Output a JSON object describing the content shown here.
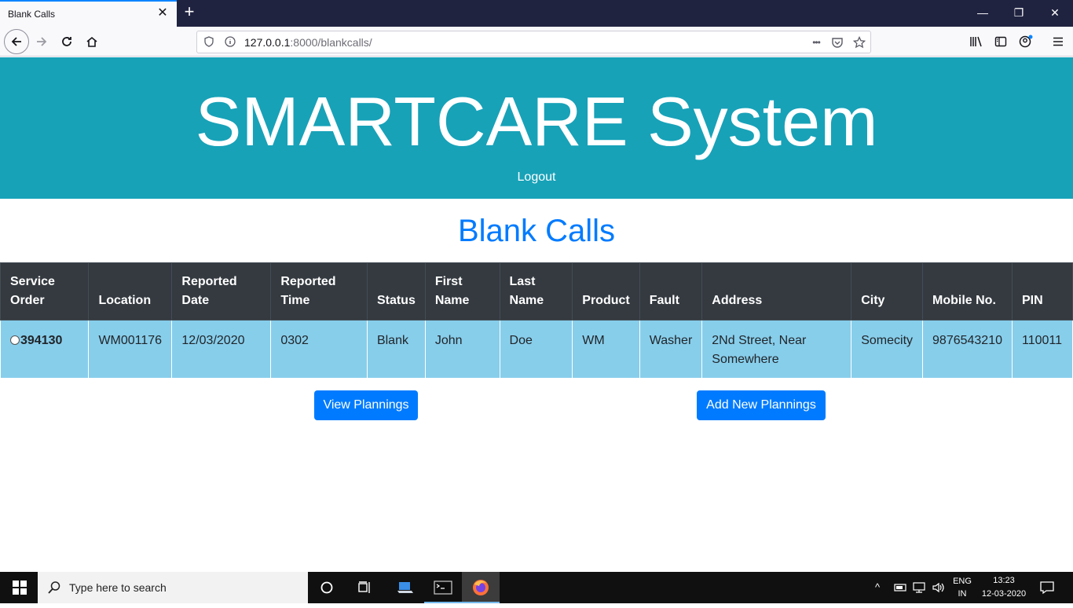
{
  "browser": {
    "tab_title": "Blank Calls",
    "tab_close": "✕",
    "new_tab": "+",
    "url_host": "127.0.0.1",
    "url_rest": ":8000/blankcalls/",
    "win_min": "—",
    "win_restore": "❐",
    "win_close": "✕",
    "page_actions": "•••"
  },
  "header": {
    "title_main": "SMARTCARE",
    "title_sub": "System",
    "logout": "Logout"
  },
  "heading": "Blank Calls",
  "table": {
    "columns": {
      "service_order": [
        "Service",
        "Order"
      ],
      "location": "Location",
      "reported_date": [
        "Reported",
        "Date"
      ],
      "reported_time": [
        "Reported",
        "Time"
      ],
      "status": "Status",
      "first_name": [
        "First",
        "Name"
      ],
      "last_name": [
        "Last",
        "Name"
      ],
      "product": "Product",
      "fault": "Fault",
      "address": "Address",
      "city": "City",
      "mobile": "Mobile No.",
      "pin": "PIN"
    },
    "rows": [
      {
        "service_order": "394130",
        "location": "WM001176",
        "reported_date": "12/03/2020",
        "reported_time": "0302",
        "status": "Blank",
        "first_name": "John",
        "last_name": "Doe",
        "product": "WM",
        "fault": "Washer",
        "address": [
          "2Nd Street, Near",
          "Somewhere"
        ],
        "city": "Somecity",
        "mobile": "9876543210",
        "pin": "110011"
      }
    ]
  },
  "buttons": {
    "view_plannings": "View Plannings",
    "add_new_plannings": "Add New Plannings"
  },
  "taskbar": {
    "search_placeholder": "Type here to search",
    "lang_top": "ENG",
    "lang_bottom": "IN",
    "time": "13:23",
    "date": "12-03-2020"
  },
  "colors": {
    "header_bg": "#17a2b8",
    "accent": "#007bff",
    "table_head_bg": "#343a40",
    "row_bg": "#87ceeb"
  }
}
